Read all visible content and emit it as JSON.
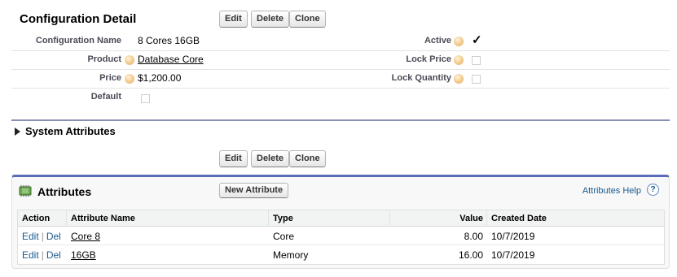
{
  "detail": {
    "title": "Configuration Detail",
    "buttons": {
      "edit": "Edit",
      "delete": "Delete",
      "clone": "Clone"
    },
    "fields": {
      "configuration_name_label": "Configuration Name",
      "configuration_name_value": "8 Cores 16GB",
      "product_label": "Product",
      "product_value": "Database Core",
      "price_label": "Price",
      "price_value": "$1,200.00",
      "default_label": "Default",
      "active_label": "Active",
      "active_check": "✓",
      "lock_price_label": "Lock Price",
      "lock_quantity_label": "Lock Quantity"
    }
  },
  "system_attributes": {
    "label": "System Attributes"
  },
  "bottom_buttons": {
    "edit": "Edit",
    "delete": "Delete",
    "clone": "Clone"
  },
  "attributes": {
    "title": "Attributes",
    "new_button": "New Attribute",
    "help_link": "Attributes Help",
    "help_icon": "?",
    "columns": [
      "Action",
      "Attribute Name",
      "Type",
      "Value",
      "Created Date"
    ],
    "rows": [
      {
        "edit": "Edit",
        "del": "Del",
        "sep": "|",
        "name": "Core 8",
        "type": "Core",
        "value": "8.00",
        "created": "10/7/2019"
      },
      {
        "edit": "Edit",
        "del": "Del",
        "sep": "|",
        "name": "16GB",
        "type": "Memory",
        "value": "16.00",
        "created": "10/7/2019"
      }
    ]
  },
  "colors": {
    "accent": "#5a6bb8",
    "link": "#1b5a8c",
    "section_line": "#8a8fb5"
  }
}
